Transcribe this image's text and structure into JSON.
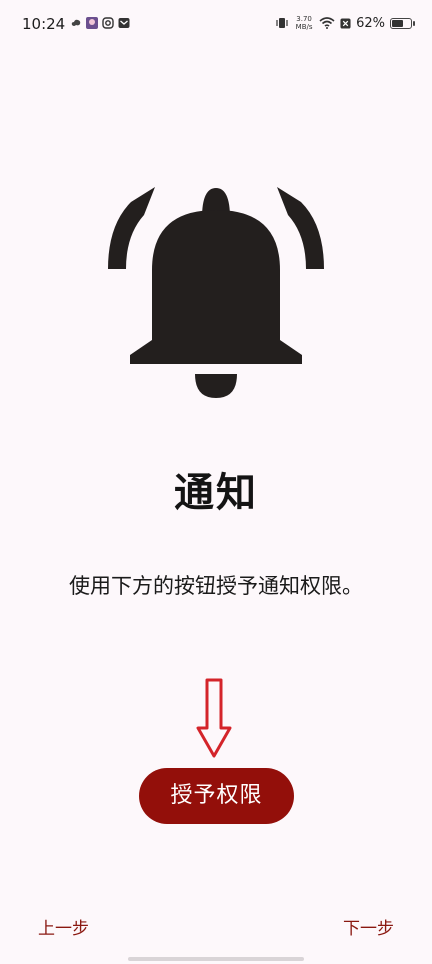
{
  "status_bar": {
    "time": "10:24",
    "net_speed_value": "3.70",
    "net_speed_unit": "MB/s",
    "battery_percent": "62%",
    "battery_level": 0.62,
    "icons": [
      "cloud-icon",
      "app-avatar-icon",
      "instagram-icon",
      "mail-icon",
      "vibrate-icon",
      "wifi-icon",
      "sim-x-icon",
      "battery-icon"
    ]
  },
  "main": {
    "icon": "bell-ringing-icon",
    "title": "通知",
    "description": "使用下方的按钮授予通知权限。",
    "arrow_icon": "arrow-down-icon",
    "arrow_color": "#d4242a",
    "grant_button_label": "授予权限",
    "button_color": "#930f0a"
  },
  "navigation": {
    "prev_label": "上一步",
    "next_label": "下一步",
    "link_color": "#8a1810"
  }
}
